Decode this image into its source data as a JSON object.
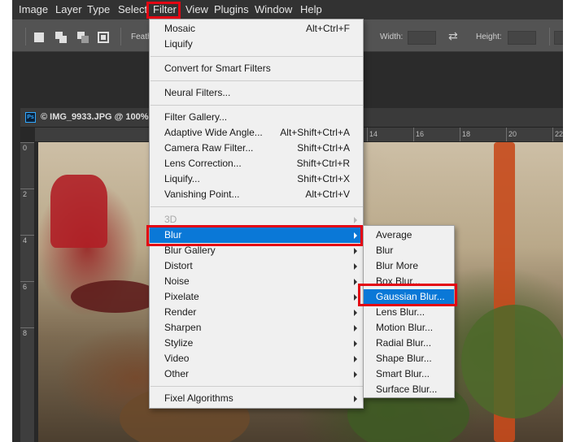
{
  "menubar": {
    "items": [
      "Image",
      "Layer",
      "Type",
      "Select",
      "Filter",
      "View",
      "Plugins",
      "Window",
      "Help"
    ],
    "active": "Filter"
  },
  "options_bar": {
    "feather_label": "Feath",
    "width_label": "Width:",
    "height_label": "Height:",
    "swap_icon": "swap-arrows-icon"
  },
  "document": {
    "title": "© IMG_9933.JPG @ 100%",
    "app_badge": "Ps",
    "ruler_top_labels": [
      "14",
      "16",
      "18",
      "20",
      "22"
    ],
    "ruler_left_labels": [
      "0",
      "2",
      "4",
      "6",
      "8"
    ]
  },
  "filter_menu": {
    "sections": [
      [
        {
          "label": "Mosaic",
          "shortcut": "Alt+Ctrl+F"
        },
        {
          "label": "Liquify",
          "shortcut": ""
        }
      ],
      [
        {
          "label": "Convert for Smart Filters",
          "shortcut": ""
        }
      ],
      [
        {
          "label": "Neural Filters...",
          "shortcut": ""
        }
      ],
      [
        {
          "label": "Filter Gallery...",
          "shortcut": ""
        },
        {
          "label": "Adaptive Wide Angle...",
          "shortcut": "Alt+Shift+Ctrl+A"
        },
        {
          "label": "Camera Raw Filter...",
          "shortcut": "Shift+Ctrl+A"
        },
        {
          "label": "Lens Correction...",
          "shortcut": "Shift+Ctrl+R"
        },
        {
          "label": "Liquify...",
          "shortcut": "Shift+Ctrl+X"
        },
        {
          "label": "Vanishing Point...",
          "shortcut": "Alt+Ctrl+V"
        }
      ],
      [
        {
          "label": "3D",
          "submenu": true,
          "disabled": true
        },
        {
          "label": "Blur",
          "submenu": true,
          "active": true
        },
        {
          "label": "Blur Gallery",
          "submenu": true
        },
        {
          "label": "Distort",
          "submenu": true
        },
        {
          "label": "Noise",
          "submenu": true
        },
        {
          "label": "Pixelate",
          "submenu": true
        },
        {
          "label": "Render",
          "submenu": true
        },
        {
          "label": "Sharpen",
          "submenu": true
        },
        {
          "label": "Stylize",
          "submenu": true
        },
        {
          "label": "Video",
          "submenu": true
        },
        {
          "label": "Other",
          "submenu": true
        }
      ],
      [
        {
          "label": "Fixel Algorithms",
          "submenu": true
        }
      ]
    ]
  },
  "blur_submenu": {
    "items": [
      "Average",
      "Blur",
      "Blur More",
      "Box Blur...",
      "Gaussian Blur...",
      "Lens Blur...",
      "Motion Blur...",
      "Radial Blur...",
      "Shape Blur...",
      "Smart Blur...",
      "Surface Blur..."
    ],
    "active": "Gaussian Blur..."
  },
  "highlight_color": "#e30613",
  "menu_selection_color": "#0a78d7"
}
